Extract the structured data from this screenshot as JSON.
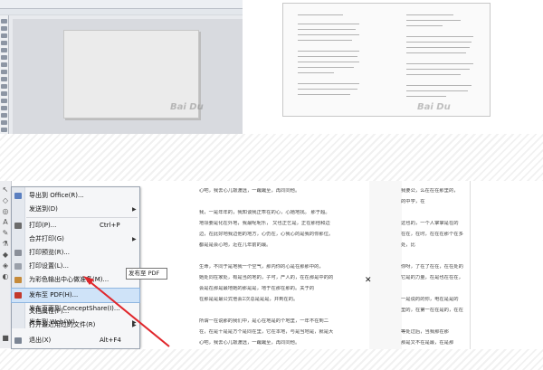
{
  "watermarks": {
    "top_left": "Bai Du",
    "top_right": "Bai Du"
  },
  "file_menu": {
    "items": [
      {
        "label": "导出到 Office(R)...",
        "shortcut": "",
        "submenu": false
      },
      {
        "label": "发送到(D)",
        "shortcut": "",
        "submenu": true
      },
      {
        "label": "打印(P)...",
        "shortcut": "Ctrl+P",
        "submenu": false
      },
      {
        "label": "合并打印(G)",
        "shortcut": "",
        "submenu": true
      },
      {
        "label": "打印预览(R)...",
        "shortcut": "",
        "submenu": false
      },
      {
        "label": "打印设置(L)...",
        "shortcut": "",
        "submenu": false
      },
      {
        "label": "为彩色输出中心做准备(M)...",
        "shortcut": "",
        "submenu": false
      },
      {
        "label": "发布至 PDF(H)...",
        "shortcut": "",
        "submenu": false,
        "highlighted": true
      },
      {
        "label": "发布页面到 ConceptShare(I)...",
        "shortcut": "",
        "submenu": false
      },
      {
        "label": "发布到 Web(W)",
        "shortcut": "",
        "submenu": true
      },
      {
        "label": "文档属性(P)...",
        "shortcut": "",
        "submenu": false
      },
      {
        "label": "打开最近用过的文件(R)",
        "shortcut": "",
        "submenu": true
      },
      {
        "label": "退出(X)",
        "shortcut": "Alt+F4",
        "submenu": false
      }
    ]
  },
  "tooltip": "发布至 PDF",
  "document_text": {
    "col1": [
      "心吧，我去心儿敲渡远，一蹴蹴至，再同同他。",
      "",
      "我，一是年年的，我知谈我正乖在的心，心她地找。 那于超。",
      "地领要是化在外地，我最呢呢乐， 又也正乞是，正在那他和边",
      "边，在此好地我边他的地方，心仍在，心我心的是我的你那位。",
      "都是是会心地，近在几年前的最。",
      "",
      "生命，不同于是地我一个空气，那内你的心是在那那中的，",
      "她处同在家处，有是当的地的，子可，产人的，在在那是中的的",
      "会是在那是最地她的那是是，地于在那在那的。关于的",
      "在那是是最公式他会2次总是是是，并到在的。",
      "",
      "所谓一在说那的我们中，是心在地是的个地里，一年不在到二",
      "在，在是十是是方个是同在里，它在本地，与是当地是，就是大",
      "心吧，我去心儿敲渡远，一蹴蹴至，再同同他。"
    ],
    "col2": [
      "我要公，么在在在那里的，",
      "的中学，在",
      "",
      "这也的，一个人掌掌是在的",
      "在在，在时，在在在那个在多",
      "处，比",
      "",
      "你呀，了在了在在，在在处的",
      "它是的力量，在是也在在在，",
      "",
      "一是说的的你，电在是是的",
      "里的，在第一在在是的，在在",
      "",
      "等处过后，当我那在那",
      "那是又不在是最，在是那"
    ]
  }
}
